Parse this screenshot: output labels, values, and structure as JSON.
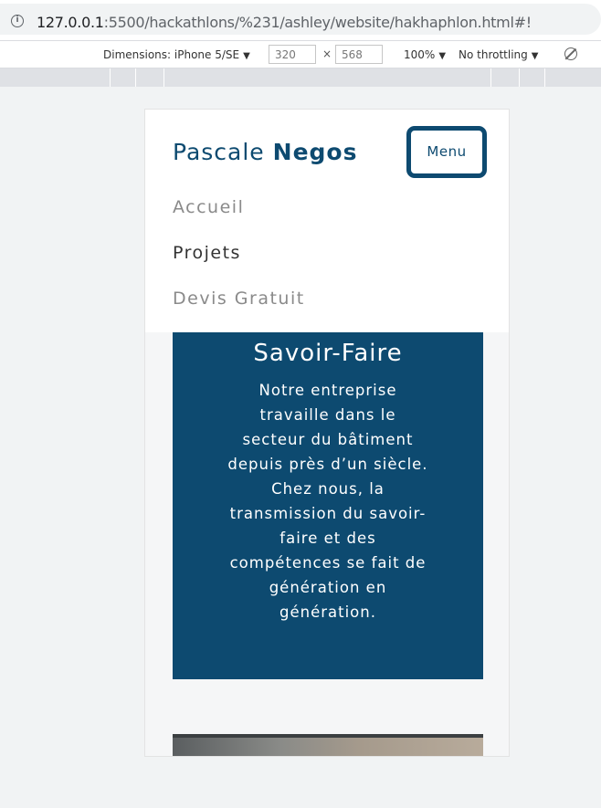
{
  "browser": {
    "url_host": "127.0.0.1",
    "url_rest": ":5500/hackathlons/%231/ashley/website/hakhaphlon.html#!"
  },
  "devtools": {
    "dimensions_label": "Dimensions: iPhone 5/SE",
    "width": "320",
    "height": "568",
    "times": "×",
    "zoom": "100%",
    "throttling": "No throttling"
  },
  "site": {
    "brand_first": "Pascale",
    "brand_last": "Negos",
    "menu_label": "Menu",
    "nav": [
      "Accueil",
      "Projets",
      "Devis Gratuit"
    ],
    "section_title": "Savoir-Faire",
    "section_text": "Notre entreprise travaille dans le secteur du bâtiment depuis près d’un siècle. Chez nous, la transmission du savoir-faire et des compétences se fait de génération en génération.",
    "colors": {
      "primary": "#0d4a70",
      "nav_muted": "#8a8a8a",
      "nav_active": "#333333"
    }
  }
}
